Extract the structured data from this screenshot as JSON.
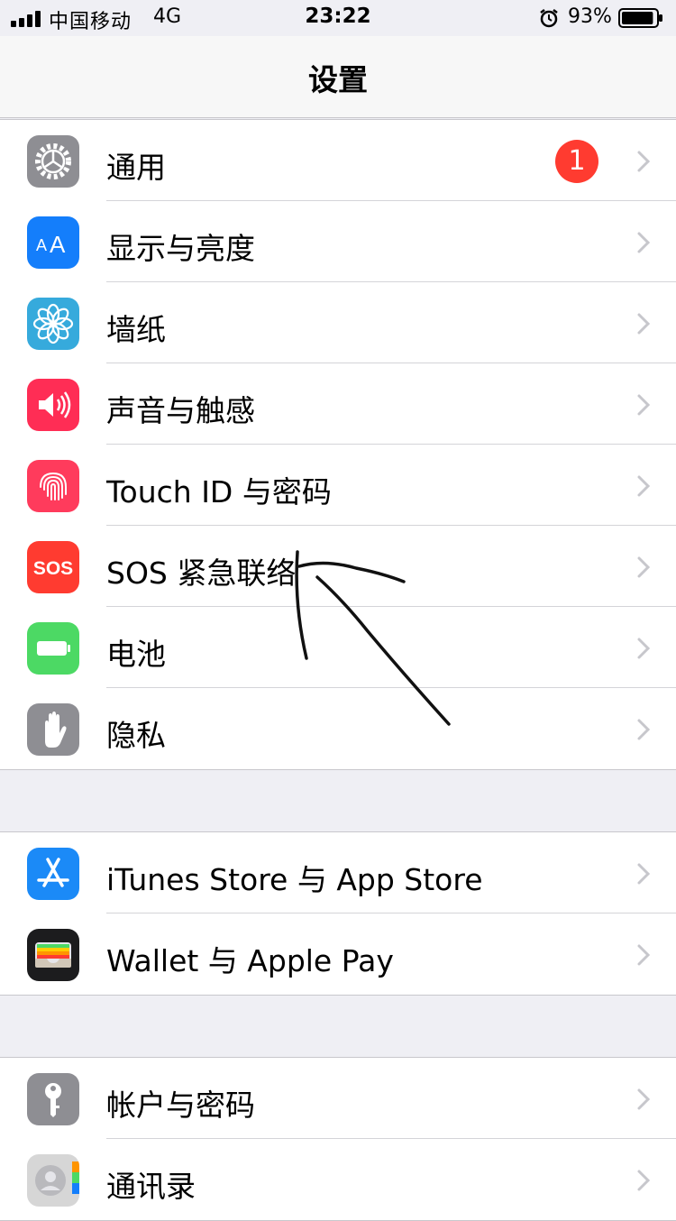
{
  "status_bar": {
    "carrier": "中国移动",
    "network": "4G",
    "time": "23:22",
    "battery": "93%",
    "battery_level": 0.93
  },
  "nav": {
    "title": "设置"
  },
  "groups": [
    {
      "items": [
        {
          "label": "通用",
          "icon": "gear-icon",
          "color": "#8e8e93",
          "badge": "1"
        },
        {
          "label": "显示与亮度",
          "icon": "text-size-icon",
          "color": "#147efb"
        },
        {
          "label": "墙纸",
          "icon": "flower-icon",
          "color": "#36aadc"
        },
        {
          "label": "声音与触感",
          "icon": "speaker-icon",
          "color": "#ff2d55"
        },
        {
          "label": "Touch ID 与密码",
          "icon": "fingerprint-icon",
          "color": "#ff3b5c"
        },
        {
          "label": "SOS 紧急联络",
          "icon": "sos-icon",
          "icon_text": "SOS",
          "color": "#ff3b30"
        },
        {
          "label": "电池",
          "icon": "battery-icon",
          "color": "#4cd964"
        },
        {
          "label": "隐私",
          "icon": "hand-icon",
          "color": "#8e8e93"
        }
      ]
    },
    {
      "items": [
        {
          "label": "iTunes Store 与 App Store",
          "icon": "app-store-icon",
          "color": "#1b8af7"
        },
        {
          "label": "Wallet 与 Apple Pay",
          "icon": "wallet-icon",
          "color": "#1c1c1e"
        }
      ]
    },
    {
      "items": [
        {
          "label": "帐户与密码",
          "icon": "key-icon",
          "color": "#8e8e93"
        },
        {
          "label": "通讯录",
          "icon": "contacts-icon",
          "color": "#d6d6d6"
        }
      ]
    }
  ]
}
